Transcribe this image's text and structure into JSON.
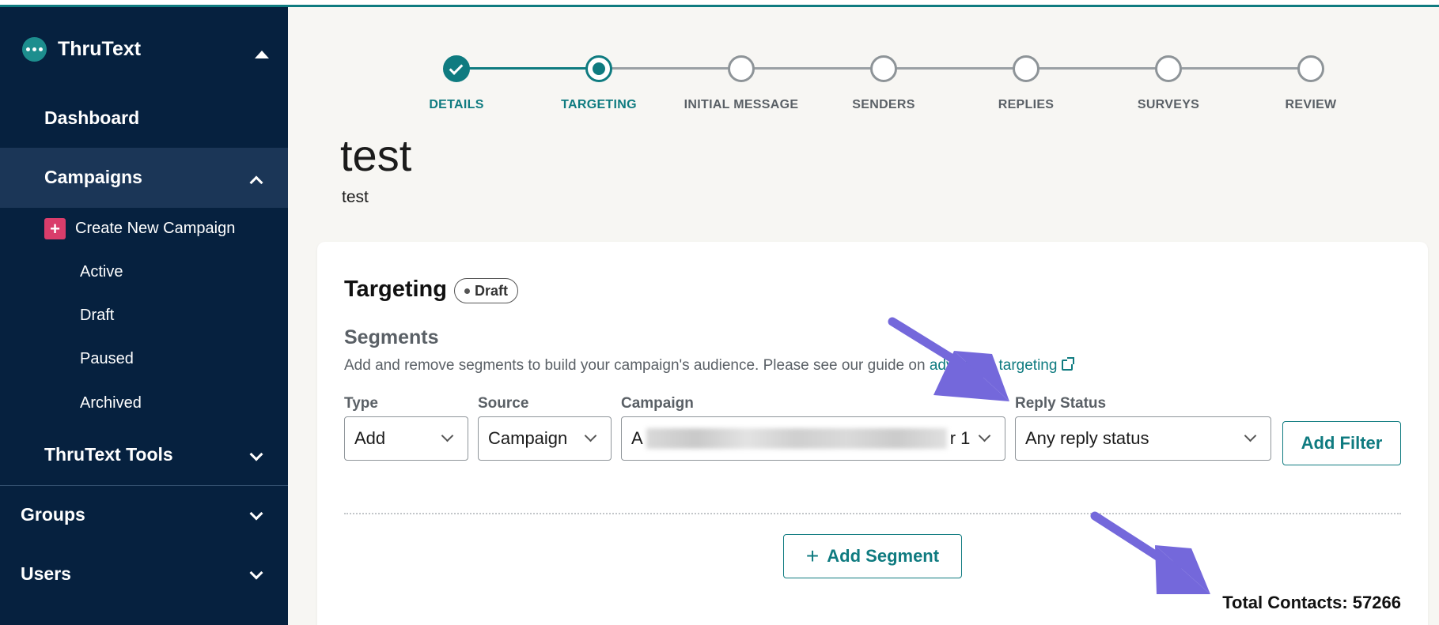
{
  "sidebar": {
    "brand": "ThruText",
    "dashboard": "Dashboard",
    "campaigns": "Campaigns",
    "create_new": "Create New Campaign",
    "sub_items": [
      "Active",
      "Draft",
      "Paused",
      "Archived"
    ],
    "tools": "ThruText Tools",
    "groups": "Groups",
    "users": "Users"
  },
  "stepper": {
    "steps": [
      "DETAILS",
      "TARGETING",
      "INITIAL MESSAGE",
      "SENDERS",
      "REPLIES",
      "SURVEYS",
      "REVIEW"
    ],
    "completed_step": "DETAILS",
    "current_step": "TARGETING"
  },
  "page": {
    "title": "test",
    "subtitle": "test"
  },
  "targeting": {
    "title": "Targeting",
    "status_badge": "Draft",
    "segments_title": "Segments",
    "description": "Add and remove segments to build your campaign's audience. Please see our guide on ",
    "guide_link": "advanced targeting",
    "fields": {
      "type_label": "Type",
      "type_value": "Add",
      "source_label": "Source",
      "source_value": "Campaign",
      "campaign_label": "Campaign",
      "campaign_value_start": "A",
      "campaign_value_end": "r 1",
      "reply_label": "Reply Status",
      "reply_value": "Any reply status"
    },
    "add_filter": "Add Filter",
    "add_segment": "Add Segment",
    "total_contacts": "Total Contacts: 57266"
  },
  "colors": {
    "sidebar_bg": "#06213f",
    "accent": "#0f7b80",
    "annotation_arrow": "#7468db",
    "create_icon": "#d93d6b"
  }
}
